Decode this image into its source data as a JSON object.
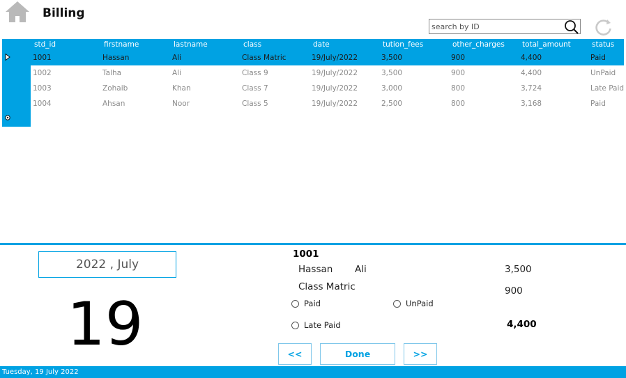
{
  "header": {
    "title": "Billing"
  },
  "search": {
    "placeholder": "search by ID"
  },
  "grid": {
    "columns": [
      "std_id",
      "firstname",
      "lastname",
      "class",
      "date",
      "tution_fees",
      "other_charges",
      "total_amount",
      "status"
    ],
    "rows": [
      [
        "1001",
        "Hassan",
        "Ali",
        "Class Matric",
        "19/July/2022",
        "3,500",
        "900",
        "4,400",
        "Paid"
      ],
      [
        "1002",
        "Talha",
        "Ali",
        "Class 9",
        "19/July/2022",
        "3,500",
        "900",
        "4,400",
        "UnPaid"
      ],
      [
        "1003",
        "Zohaib",
        "Khan",
        "Class 7",
        "19/July/2022",
        "3,000",
        "800",
        "3,724",
        "Late Paid"
      ],
      [
        "1004",
        "Ahsan",
        "Noor",
        "Class 5",
        "19/July/2022",
        "2,500",
        "800",
        "3,168",
        "Paid"
      ]
    ],
    "selected_row": 0
  },
  "calendar": {
    "month_label": "2022 , July",
    "day": "19"
  },
  "details": {
    "std_id": "1001",
    "firstname": "Hassan",
    "lastname": "Ali",
    "class": "Class Matric",
    "tution_fees": "3,500",
    "other_charges": "900",
    "total_amount": "4,400"
  },
  "status_options": {
    "paid": "Paid",
    "unpaid": "UnPaid",
    "late_paid": "Late Paid"
  },
  "nav": {
    "prev": "<<",
    "done": "Done",
    "next": ">>"
  },
  "status_bar": {
    "text": "Tuesday, 19 July 2022"
  },
  "colors": {
    "accent": "#00a2e3"
  }
}
